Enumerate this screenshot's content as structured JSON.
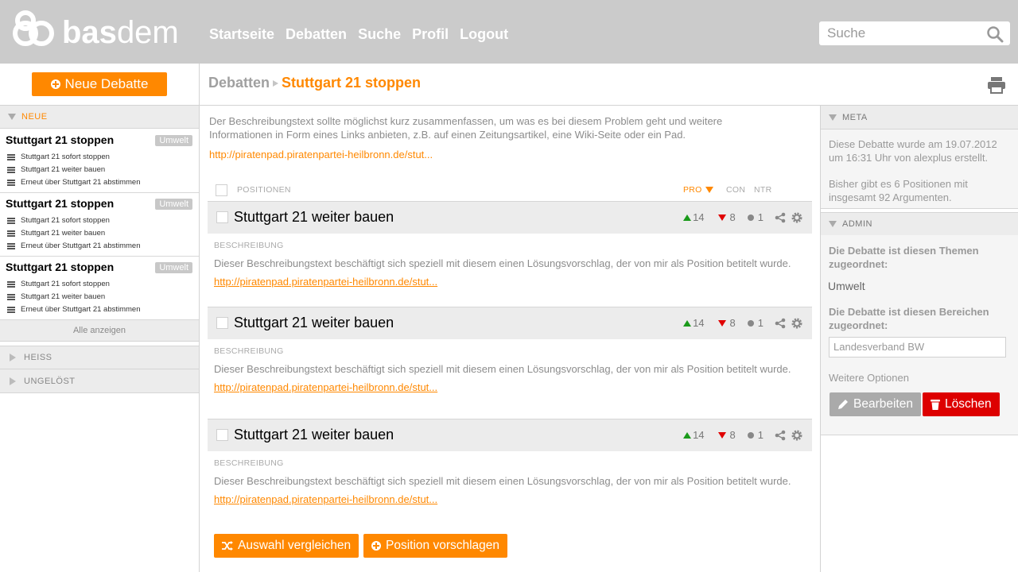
{
  "header": {
    "logo": {
      "bold": "bas",
      "light": "dem"
    },
    "nav": [
      "Startseite",
      "Debatten",
      "Suche",
      "Profil",
      "Logout"
    ],
    "search_placeholder": "Suche"
  },
  "sidebar": {
    "new_debate_label": "Neue Debatte",
    "sections": {
      "new": "NEUE",
      "hot": "HEISS",
      "unsolved": "UNGELÖST"
    },
    "debates": [
      {
        "title": "Stuttgart 21 stoppen",
        "tag": "Umwelt",
        "positions": [
          "Stuttgart 21 sofort stoppen",
          "Stuttgart 21 weiter bauen",
          "Erneut über Stuttgart 21 abstimmen"
        ]
      },
      {
        "title": "Stuttgart 21 stoppen",
        "tag": "Umwelt",
        "positions": [
          "Stuttgart 21 sofort stoppen",
          "Stuttgart 21 weiter bauen",
          "Erneut über Stuttgart 21 abstimmen"
        ]
      },
      {
        "title": "Stuttgart 21 stoppen",
        "tag": "Umwelt",
        "positions": [
          "Stuttgart 21 sofort stoppen",
          "Stuttgart 21 weiter bauen",
          "Erneut über Stuttgart 21 abstimmen"
        ]
      }
    ],
    "show_all": "Alle anzeigen"
  },
  "breadcrumb": {
    "parent": "Debatten",
    "current": "Stuttgart 21 stoppen"
  },
  "main": {
    "description": "Der Beschreibungstext sollte möglichst kurz zusammenfassen, um was es bei diesem Problem geht und weitere Informationen in Form eines Links anbieten, z.B. auf einen Zeitungsartikel, eine Wiki-Seite oder ein Pad.",
    "link": "http://piratenpad.piratenpartei-heilbronn.de/stut...",
    "columns": {
      "positions": "POSITIONEN",
      "pro": "PRO",
      "con": "CON",
      "ntr": "NTR"
    },
    "positions": [
      {
        "title": "Stuttgart 21 weiter bauen",
        "pro": "14",
        "con": "8",
        "ntr": "1",
        "label": "BESCHREIBUNG",
        "text": "Dieser Beschreibungstext beschäftigt sich speziell mit diesem einen Lösungsvorschlag, der von mir als Position betitelt wurde.",
        "link": "http://piratenpad.piratenpartei-heilbronn.de/stut..."
      },
      {
        "title": "Stuttgart 21 weiter bauen",
        "pro": "14",
        "con": "8",
        "ntr": "1",
        "label": "BESCHREIBUNG",
        "text": "Dieser Beschreibungstext beschäftigt sich speziell mit diesem einen Lösungsvorschlag, der von mir als Position betitelt wurde.",
        "link": "http://piratenpad.piratenpartei-heilbronn.de/stut..."
      },
      {
        "title": "Stuttgart 21 weiter bauen",
        "pro": "14",
        "con": "8",
        "ntr": "1",
        "label": "BESCHREIBUNG",
        "text": "Dieser Beschreibungstext beschäftigt sich speziell mit diesem einen Lösungsvorschlag, der von mir als Position betitelt wurde.",
        "link": "http://piratenpad.piratenpartei-heilbronn.de/stut..."
      }
    ],
    "compare_label": "Auswahl vergleichen",
    "propose_label": "Position vorschlagen"
  },
  "right": {
    "meta_title": "META",
    "meta_text_1": "Diese Debatte wurde am 19.07.2012 um 16:31 Uhr von alexplus erstellt.",
    "meta_text_2": "Bisher gibt es 6 Positionen mit insgesamt 92 Argumenten.",
    "admin_title": "ADMIN",
    "themes_q": "Die Debatte ist diesen Themen zugeordnet:",
    "theme": "Umwelt",
    "areas_q": "Die Debatte ist diesen Bereichen zugeordnet:",
    "area_value": "Landesverband BW",
    "more_options": "Weitere Optionen",
    "edit_label": "Bearbeiten",
    "delete_label": "Löschen"
  },
  "colors": {
    "accent": "#ff8800",
    "header_bg": "#cbcbcb",
    "pro": "#1a9a1a",
    "con": "#e00000",
    "delete": "#dd0000"
  }
}
